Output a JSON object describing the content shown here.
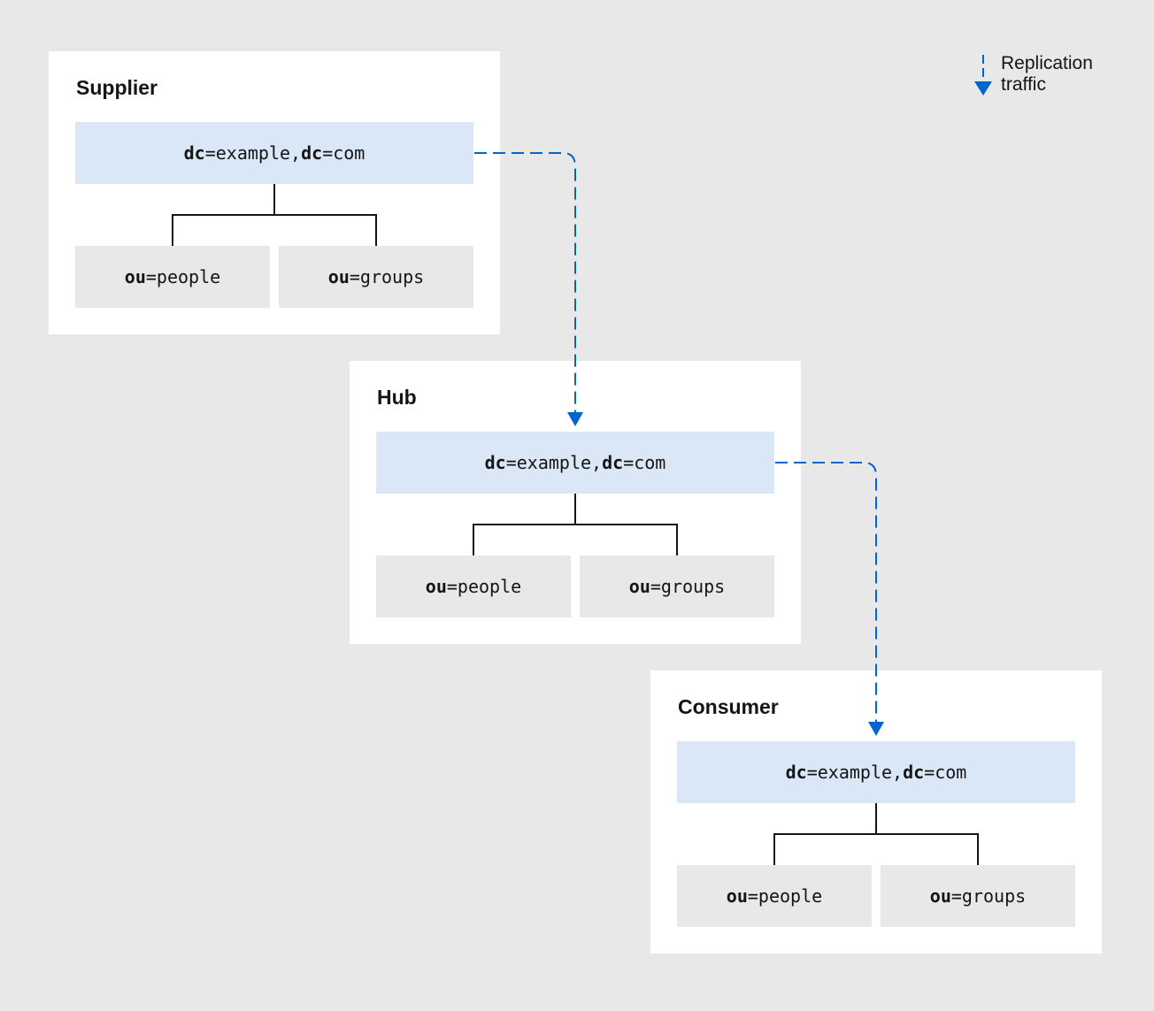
{
  "legend": {
    "line1": "Replication",
    "line2": "traffic",
    "icon": "dashed-arrow-down-icon"
  },
  "colors": {
    "arrow": "#0066cc",
    "root_fill": "#d9e7f6",
    "child_fill": "#e8e8e8",
    "background": "#e8e8e8"
  },
  "panels": [
    {
      "title": "Supplier",
      "root": [
        "dc",
        "=example,",
        "dc",
        "=com"
      ],
      "children": [
        [
          "ou",
          "=people"
        ],
        [
          "ou",
          "=groups"
        ]
      ]
    },
    {
      "title": "Hub",
      "root": [
        "dc",
        "=example,",
        "dc",
        "=com"
      ],
      "children": [
        [
          "ou",
          "=people"
        ],
        [
          "ou",
          "=groups"
        ]
      ]
    },
    {
      "title": "Consumer",
      "root": [
        "dc",
        "=example,",
        "dc",
        "=com"
      ],
      "children": [
        [
          "ou",
          "=people"
        ],
        [
          "ou",
          "=groups"
        ]
      ]
    }
  ]
}
